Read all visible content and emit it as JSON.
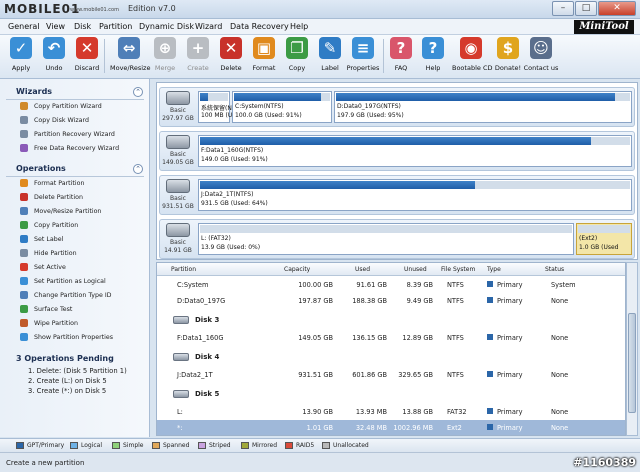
{
  "window": {
    "logo": "MOBILE01",
    "logo_sub": "www.mobile01.com",
    "title": "Edition v7.0",
    "brand": "MiniTool"
  },
  "menu": [
    "General",
    "View",
    "Disk",
    "Partition",
    "Dynamic Disk",
    "Wizard",
    "Data Recovery",
    "Help"
  ],
  "toolbar": [
    {
      "label": "Apply",
      "icon": "check-icon",
      "color": "#3a8fd6",
      "glyph": "✓",
      "disabled": false
    },
    {
      "label": "Undo",
      "icon": "undo-icon",
      "color": "#3a8fd6",
      "glyph": "↶",
      "disabled": false
    },
    {
      "label": "Discard",
      "icon": "discard-icon",
      "color": "#d53a2c",
      "glyph": "✕",
      "disabled": false
    },
    {
      "label": "Move/Resize",
      "icon": "move-resize-icon",
      "color": "#4f7fb8",
      "glyph": "⇔",
      "disabled": false
    },
    {
      "label": "Merge",
      "icon": "merge-icon",
      "color": "#4f7fb8",
      "glyph": "⊕",
      "disabled": true
    },
    {
      "label": "Create",
      "icon": "create-icon",
      "color": "#4f7fb8",
      "glyph": "+",
      "disabled": true
    },
    {
      "label": "Delete",
      "icon": "delete-icon",
      "color": "#c8322a",
      "glyph": "✕",
      "disabled": false
    },
    {
      "label": "Format",
      "icon": "format-icon",
      "color": "#e08a1e",
      "glyph": "▣",
      "disabled": false
    },
    {
      "label": "Copy",
      "icon": "copy-icon",
      "color": "#3c9b45",
      "glyph": "❐",
      "disabled": false
    },
    {
      "label": "Label",
      "icon": "label-icon",
      "color": "#2f7cc5",
      "glyph": "✎",
      "disabled": false
    },
    {
      "label": "Properties",
      "icon": "properties-icon",
      "color": "#3a8fd6",
      "glyph": "≡",
      "disabled": false
    },
    {
      "label": "FAQ",
      "icon": "faq-icon",
      "color": "#d9566b",
      "glyph": "?",
      "disabled": false
    },
    {
      "label": "Help",
      "icon": "help-icon",
      "color": "#3a8fd6",
      "glyph": "?",
      "disabled": false
    },
    {
      "label": "Bootable CD",
      "icon": "bootable-cd-icon",
      "color": "#d53a2c",
      "glyph": "◉",
      "disabled": false
    },
    {
      "label": "Donate!",
      "icon": "donate-icon",
      "color": "#e0a51e",
      "glyph": "$",
      "disabled": false
    },
    {
      "label": "Contact us",
      "icon": "contact-icon",
      "color": "#5a6e8c",
      "glyph": "☺",
      "disabled": false
    }
  ],
  "sidebar": {
    "wizards_title": "Wizards",
    "wizards": [
      {
        "label": "Copy Partition Wizard",
        "icon": "copy-partition-wizard-icon",
        "color": "#d08a2a"
      },
      {
        "label": "Copy Disk Wizard",
        "icon": "copy-disk-wizard-icon",
        "color": "#7a8ca2"
      },
      {
        "label": "Partition Recovery Wizard",
        "icon": "partition-recovery-wizard-icon",
        "color": "#7a8ca2"
      },
      {
        "label": "Free Data Recovery Wizard",
        "icon": "data-recovery-wizard-icon",
        "color": "#8a5ab8"
      }
    ],
    "operations_title": "Operations",
    "operations": [
      {
        "label": "Format Partition",
        "icon": "format-partition-icon",
        "color": "#e08a1e"
      },
      {
        "label": "Delete Partition",
        "icon": "delete-partition-icon",
        "color": "#c8322a"
      },
      {
        "label": "Move/Resize Partition",
        "icon": "move-resize-partition-icon",
        "color": "#4f7fb8"
      },
      {
        "label": "Copy Partition",
        "icon": "copy-partition-icon",
        "color": "#3c9b45"
      },
      {
        "label": "Set Label",
        "icon": "set-label-icon",
        "color": "#2f7cc5"
      },
      {
        "label": "Hide Partition",
        "icon": "hide-partition-icon",
        "color": "#7a8ca2"
      },
      {
        "label": "Set Active",
        "icon": "set-active-icon",
        "color": "#d53a2c"
      },
      {
        "label": "Set Partition as Logical",
        "icon": "set-logical-icon",
        "color": "#3a8fd6"
      },
      {
        "label": "Change Partition Type ID",
        "icon": "change-type-id-icon",
        "color": "#4f7fb8"
      },
      {
        "label": "Surface Test",
        "icon": "surface-test-icon",
        "color": "#3c9b45"
      },
      {
        "label": "Wipe Partition",
        "icon": "wipe-partition-icon",
        "color": "#c05a2a"
      },
      {
        "label": "Show Partition Properties",
        "icon": "partition-properties-icon",
        "color": "#3a8fd6"
      }
    ],
    "pending_title": "3 Operations Pending",
    "pending": [
      "1. Delete: (Disk 5 Partition 1)",
      "2. Create (L:) on Disk 5",
      "3. Create (*:) on Disk 5"
    ]
  },
  "diskmap": [
    {
      "type": "Basic",
      "size": "297.97 GB",
      "parts": [
        {
          "name": "系統保留(NT",
          "info": "100 MB (Used",
          "used": 0.3,
          "selected": false
        },
        {
          "name": "C:System(NTFS)",
          "info": "100.0 GB (Used: 91%)",
          "used": 0.91,
          "selected": false
        },
        {
          "name": "D:Data0_197G(NTFS)",
          "info": "197.9 GB (Used: 95%)",
          "used": 0.95,
          "selected": false
        }
      ]
    },
    {
      "type": "Basic",
      "size": "149.05 GB",
      "parts": [
        {
          "name": "F:Data1_160G(NTFS)",
          "info": "149.0 GB (Used: 91%)",
          "used": 0.91,
          "selected": false
        }
      ]
    },
    {
      "type": "Basic",
      "size": "931.51 GB",
      "parts": [
        {
          "name": "J:Data2_1T(NTFS)",
          "info": "931.5 GB (Used: 64%)",
          "used": 0.64,
          "selected": false
        }
      ]
    },
    {
      "type": "Basic",
      "size": "14.91 GB",
      "parts": [
        {
          "name": "L: (FAT32)",
          "info": "13.9 GB (Used: 0%)",
          "used": 0.0,
          "selected": false
        },
        {
          "name": "(Ext2)",
          "info": "1.0 GB (Used",
          "used": 0.0,
          "selected": true
        }
      ]
    }
  ],
  "table": {
    "headers": [
      "Partition",
      "Capacity",
      "Used",
      "Unused",
      "File System",
      "Type",
      "Status"
    ],
    "rows": [
      {
        "kind": "row",
        "cells": [
          "C:System",
          "100.00 GB",
          "91.61 GB",
          "8.39 GB",
          "NTFS",
          "Primary",
          "System"
        ],
        "selected": false
      },
      {
        "kind": "row",
        "cells": [
          "D:Data0_197G",
          "197.87 GB",
          "188.38 GB",
          "9.49 GB",
          "NTFS",
          "Primary",
          "None"
        ],
        "selected": false
      },
      {
        "kind": "disk",
        "label": "Disk 3"
      },
      {
        "kind": "row",
        "cells": [
          "F:Data1_160G",
          "149.05 GB",
          "136.15 GB",
          "12.89 GB",
          "NTFS",
          "Primary",
          "None"
        ],
        "selected": false
      },
      {
        "kind": "disk",
        "label": "Disk 4"
      },
      {
        "kind": "row",
        "cells": [
          "J:Data2_1T",
          "931.51 GB",
          "601.86 GB",
          "329.65 GB",
          "NTFS",
          "Primary",
          "None"
        ],
        "selected": false
      },
      {
        "kind": "disk",
        "label": "Disk 5"
      },
      {
        "kind": "row",
        "cells": [
          "L:",
          "13.90 GB",
          "13.93 MB",
          "13.88 GB",
          "FAT32",
          "Primary",
          "None"
        ],
        "selected": false
      },
      {
        "kind": "row",
        "cells": [
          "*:",
          "1.01 GB",
          "32.48 MB",
          "1002.96 MB",
          "Ext2",
          "Primary",
          "None"
        ],
        "selected": true
      }
    ]
  },
  "legend": [
    {
      "label": "GPT/Primary",
      "color": "#2b66a8"
    },
    {
      "label": "Logical",
      "color": "#6fb2e6"
    },
    {
      "label": "Simple",
      "color": "#8fd17a"
    },
    {
      "label": "Spanned",
      "color": "#e0a85a"
    },
    {
      "label": "Striped",
      "color": "#c9a3e0"
    },
    {
      "label": "Mirrored",
      "color": "#a0a83a"
    },
    {
      "label": "RAID5",
      "color": "#d94a3a"
    },
    {
      "label": "Unallocated",
      "color": "#b8b8b8"
    }
  ],
  "status": {
    "text": "Create a new partition",
    "watermark": "#1160389"
  }
}
